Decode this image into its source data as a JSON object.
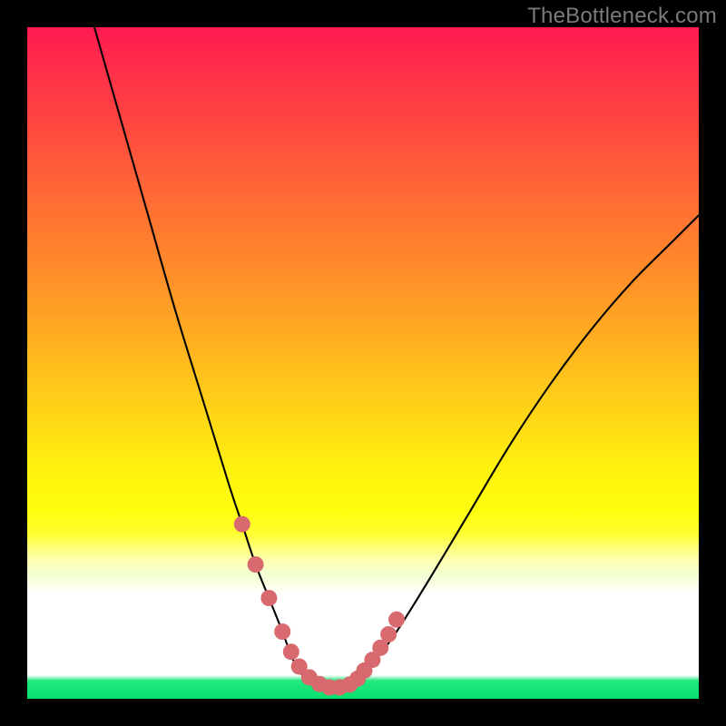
{
  "watermark": "TheBottleneck.com",
  "colors": {
    "frame_bg": "#000000",
    "curve_stroke": "#000000",
    "marker_fill": "#d86a6f",
    "marker_stroke": "#d86a6f",
    "bottom_band": "#06e06e"
  },
  "chart_data": {
    "type": "line",
    "title": "",
    "xlabel": "",
    "ylabel": "",
    "xlim": [
      0,
      100
    ],
    "ylim": [
      0,
      100
    ],
    "grid": false,
    "legend": false,
    "note": "Axes unlabeled; values estimated from pixel positions on 0–100 normalized scale. y represents distance from bottom (0 = bottom green band, 100 = top).",
    "series": [
      {
        "name": "curve",
        "x": [
          10,
          14,
          18,
          22,
          26,
          30,
          32,
          34,
          36,
          38,
          39.5,
          41,
          43,
          45,
          47,
          49,
          50,
          52,
          55,
          60,
          66,
          72,
          78,
          84,
          90,
          96,
          100
        ],
        "y": [
          100,
          86,
          72,
          58,
          45,
          32,
          26,
          20,
          15,
          10,
          6,
          3.5,
          2.2,
          1.6,
          1.6,
          2.4,
          3.8,
          6,
          10,
          18,
          28,
          38,
          47,
          55,
          62,
          68,
          72
        ]
      }
    ],
    "markers": {
      "name": "highlighted-points",
      "shape": "circle",
      "radius_px": 9,
      "x": [
        32.0,
        34.0,
        36.0,
        38.0,
        39.3,
        40.5,
        42.0,
        43.5,
        45.0,
        46.5,
        48.0,
        49.2,
        50.2,
        51.4,
        52.6,
        53.8,
        55.0
      ],
      "y": [
        26.0,
        20.0,
        15.0,
        10.0,
        7.0,
        4.8,
        3.2,
        2.2,
        1.7,
        1.7,
        2.1,
        3.0,
        4.2,
        5.8,
        7.6,
        9.6,
        11.8
      ]
    },
    "background_gradient": {
      "direction": "top-to-bottom",
      "stops": [
        {
          "pos": 0.0,
          "color": "#ff1a50"
        },
        {
          "pos": 0.25,
          "color": "#ff6a35"
        },
        {
          "pos": 0.58,
          "color": "#ffd716"
        },
        {
          "pos": 0.77,
          "color": "#ffff66"
        },
        {
          "pos": 0.85,
          "color": "#ffffff"
        },
        {
          "pos": 0.97,
          "color": "#ffffff"
        },
        {
          "pos": 1.0,
          "color": "#06e06e"
        }
      ]
    }
  }
}
